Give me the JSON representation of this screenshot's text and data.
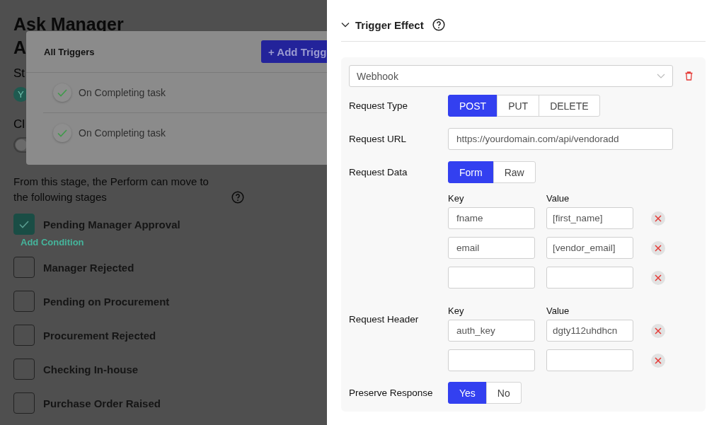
{
  "page": {
    "title_lines": [
      "Ask Manager",
      "A"
    ],
    "stage_label": "St",
    "stage_chip": "Y",
    "close_label": "Cl",
    "close_toggle": {
      "on": false
    },
    "move_text": "From this stage, the Perform can move to the following stages",
    "stages": [
      {
        "label": "Pending Manager Approval",
        "checked": true,
        "action": "Add Condition"
      },
      {
        "label": "Manager Rejected",
        "checked": false
      },
      {
        "label": "Pending on Procurement",
        "checked": false
      },
      {
        "label": "Procurement Rejected",
        "checked": false
      },
      {
        "label": "Checking In-house",
        "checked": false
      },
      {
        "label": "Purchase Order Raised",
        "checked": false
      }
    ]
  },
  "triggers_modal": {
    "title": "All Triggers",
    "add_button": "+ Add Trigg",
    "items": [
      {
        "label": "On Completing task",
        "checked": true
      },
      {
        "label": "On Completing task",
        "checked": true
      }
    ]
  },
  "drawer": {
    "section": {
      "title": "Trigger Effect",
      "expanded": true
    },
    "effect": {
      "type": "Webhook",
      "request_type": {
        "label": "Request Type",
        "options": [
          {
            "label": "POST",
            "selected": true
          },
          {
            "label": "PUT",
            "selected": false
          },
          {
            "label": "DELETE",
            "selected": false
          }
        ]
      },
      "request_url": {
        "label": "Request URL",
        "value": "https://yourdomain.com/api/vendoradd"
      },
      "request_data": {
        "label": "Request Data",
        "options": [
          {
            "label": "Form",
            "selected": true
          },
          {
            "label": "Raw",
            "selected": false
          }
        ],
        "key_heading": "Key",
        "value_heading": "Value",
        "pairs": [
          {
            "kind": "filled",
            "key": "fname",
            "value": "[first_name]"
          },
          {
            "kind": "filled",
            "key": "email",
            "value": "[vendor_email]"
          },
          {
            "kind": "blank"
          }
        ]
      },
      "request_header": {
        "label": "Request Header",
        "key_heading": "Key",
        "value_heading": "Value",
        "pairs": [
          {
            "kind": "filled",
            "key": "auth_key",
            "value": "dgty112uhdhcn"
          },
          {
            "kind": "blank"
          }
        ]
      },
      "preserve_response": {
        "label": "Preserve Response",
        "options": [
          {
            "label": "Yes",
            "selected": true
          },
          {
            "label": "No",
            "selected": false
          }
        ]
      }
    }
  }
}
